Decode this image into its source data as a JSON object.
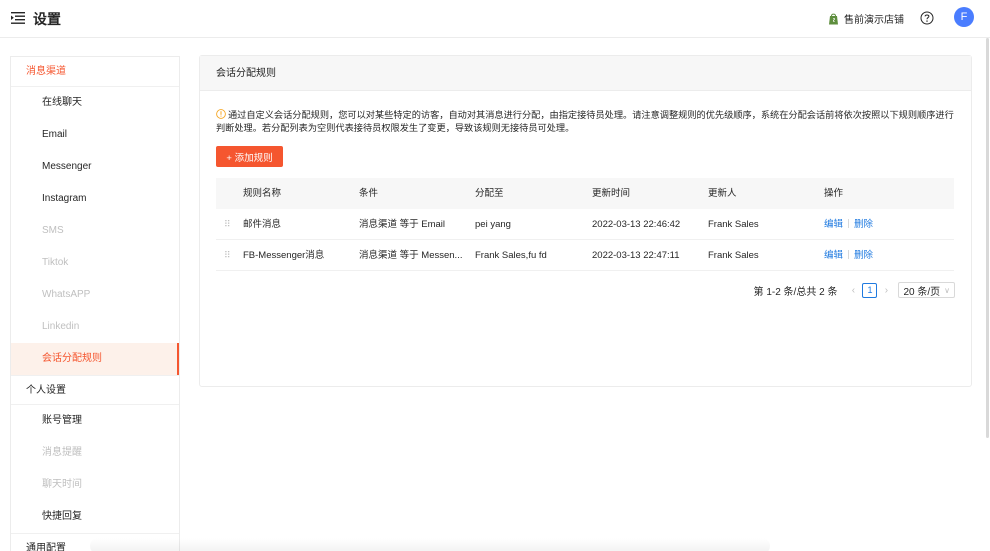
{
  "header": {
    "title": "设置",
    "store_name": "售前演示店铺",
    "avatar_letter": "F"
  },
  "sidebar": {
    "groups": [
      {
        "label": "消息渠道",
        "items": [
          {
            "label": "在线聊天"
          },
          {
            "label": "Email"
          },
          {
            "label": "Messenger"
          },
          {
            "label": "Instagram"
          },
          {
            "label": "SMS"
          },
          {
            "label": "Tiktok"
          },
          {
            "label": "WhatsAPP"
          },
          {
            "label": "Linkedin"
          },
          {
            "label": "会话分配规则"
          }
        ]
      },
      {
        "label": "个人设置",
        "items": [
          {
            "label": "账号管理"
          },
          {
            "label": "消息提醒"
          },
          {
            "label": "聊天时间"
          },
          {
            "label": "快捷回复"
          }
        ]
      },
      {
        "label": "通用配置",
        "items": []
      }
    ]
  },
  "panel": {
    "title": "会话分配规则",
    "notice": "通过自定义会话分配规则，您可以对某些特定的访客，自动对其消息进行分配，由指定接待员处理。请注意调整规则的优先级顺序，系统在分配会话前将依次按照以下规则顺序进行判断处理。若分配列表为空则代表接待员权限发生了变更，导致该规则无接待员可处理。",
    "add_button": "+ 添加规则"
  },
  "table": {
    "columns": {
      "name": "规则名称",
      "condition": "条件",
      "assign": "分配至",
      "updated_at": "更新时间",
      "updated_by": "更新人",
      "ops": "操作"
    },
    "rows": [
      {
        "name": "邮件消息",
        "condition": "消息渠道 等于 Email",
        "assign": "pei yang",
        "updated_at": "2022-03-13 22:46:42",
        "updated_by": "Frank Sales",
        "edit": "编辑",
        "delete": "删除"
      },
      {
        "name": "FB-Messenger消息",
        "condition": "消息渠道 等于 Messen...",
        "assign": "Frank Sales,fu fd",
        "updated_at": "2022-03-13 22:47:11",
        "updated_by": "Frank Sales",
        "edit": "编辑",
        "delete": "删除"
      }
    ]
  },
  "pagination": {
    "summary": "第 1-2 条/总共 2 条",
    "current_page": "1",
    "page_size": "20 条/页"
  },
  "colors": {
    "accent": "#f5562f",
    "link": "#1f7ae0",
    "avatar": "#4a7dff"
  }
}
